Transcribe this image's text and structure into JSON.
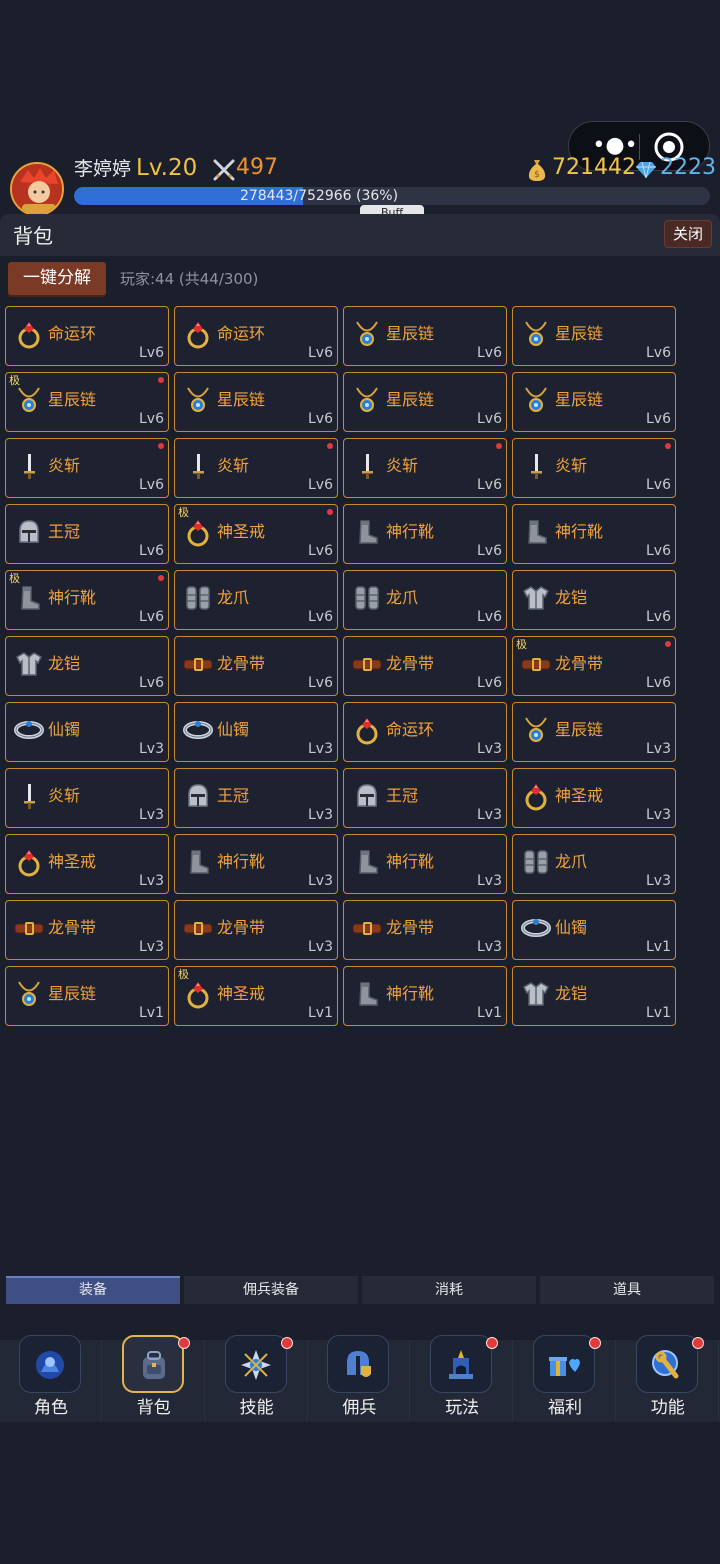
{
  "header": {
    "player_name": "李婷婷",
    "level": "Lv.20",
    "power": "497",
    "gold": "721442",
    "gems": "2223",
    "xp_text": "278443/752966 (36%)",
    "xp_fraction": 0.36,
    "buff_label": "Buff"
  },
  "window": {
    "title": "背包",
    "close_label": "关闭",
    "decompose_label": "一键分解",
    "player_info": "玩家:44 (共44/300)"
  },
  "items": [
    {
      "name": "命运环",
      "level": "Lv6",
      "icon": "ring-icon",
      "badge": "",
      "dot": false
    },
    {
      "name": "命运环",
      "level": "Lv6",
      "icon": "ring-icon",
      "badge": "",
      "dot": false
    },
    {
      "name": "星辰链",
      "level": "Lv6",
      "icon": "necklace-icon",
      "badge": "",
      "dot": false
    },
    {
      "name": "星辰链",
      "level": "Lv6",
      "icon": "necklace-icon",
      "badge": "",
      "dot": false
    },
    {
      "name": "星辰链",
      "level": "Lv6",
      "icon": "necklace-icon",
      "badge": "极",
      "dot": true
    },
    {
      "name": "星辰链",
      "level": "Lv6",
      "icon": "necklace-icon",
      "badge": "",
      "dot": false
    },
    {
      "name": "星辰链",
      "level": "Lv6",
      "icon": "necklace-icon",
      "badge": "",
      "dot": false
    },
    {
      "name": "星辰链",
      "level": "Lv6",
      "icon": "necklace-icon",
      "badge": "",
      "dot": false
    },
    {
      "name": "炎斩",
      "level": "Lv6",
      "icon": "sword-icon",
      "badge": "",
      "dot": true
    },
    {
      "name": "炎斩",
      "level": "Lv6",
      "icon": "sword-icon",
      "badge": "",
      "dot": true
    },
    {
      "name": "炎斩",
      "level": "Lv6",
      "icon": "sword-icon",
      "badge": "",
      "dot": true
    },
    {
      "name": "炎斩",
      "level": "Lv6",
      "icon": "sword-icon",
      "badge": "",
      "dot": true
    },
    {
      "name": "王冠",
      "level": "Lv6",
      "icon": "helmet-icon",
      "badge": "",
      "dot": false
    },
    {
      "name": "神圣戒",
      "level": "Lv6",
      "icon": "ring-icon",
      "badge": "极",
      "dot": true
    },
    {
      "name": "神行靴",
      "level": "Lv6",
      "icon": "boot-icon",
      "badge": "",
      "dot": false
    },
    {
      "name": "神行靴",
      "level": "Lv6",
      "icon": "boot-icon",
      "badge": "",
      "dot": false
    },
    {
      "name": "神行靴",
      "level": "Lv6",
      "icon": "boot-icon",
      "badge": "极",
      "dot": true
    },
    {
      "name": "龙爪",
      "level": "Lv6",
      "icon": "gauntlet-icon",
      "badge": "",
      "dot": false
    },
    {
      "name": "龙爪",
      "level": "Lv6",
      "icon": "gauntlet-icon",
      "badge": "",
      "dot": false
    },
    {
      "name": "龙铠",
      "level": "Lv6",
      "icon": "armor-icon",
      "badge": "",
      "dot": false
    },
    {
      "name": "龙铠",
      "level": "Lv6",
      "icon": "armor-icon",
      "badge": "",
      "dot": false
    },
    {
      "name": "龙骨带",
      "level": "Lv6",
      "icon": "belt-icon",
      "badge": "",
      "dot": false
    },
    {
      "name": "龙骨带",
      "level": "Lv6",
      "icon": "belt-icon",
      "badge": "",
      "dot": false
    },
    {
      "name": "龙骨带",
      "level": "Lv6",
      "icon": "belt-icon",
      "badge": "极",
      "dot": true
    },
    {
      "name": "仙镯",
      "level": "Lv3",
      "icon": "bracelet-icon",
      "badge": "",
      "dot": false
    },
    {
      "name": "仙镯",
      "level": "Lv3",
      "icon": "bracelet-icon",
      "badge": "",
      "dot": false
    },
    {
      "name": "命运环",
      "level": "Lv3",
      "icon": "ring-icon",
      "badge": "",
      "dot": false
    },
    {
      "name": "星辰链",
      "level": "Lv3",
      "icon": "necklace-icon",
      "badge": "",
      "dot": false
    },
    {
      "name": "炎斩",
      "level": "Lv3",
      "icon": "sword-icon",
      "badge": "",
      "dot": false
    },
    {
      "name": "王冠",
      "level": "Lv3",
      "icon": "helmet-icon",
      "badge": "",
      "dot": false
    },
    {
      "name": "王冠",
      "level": "Lv3",
      "icon": "helmet-icon",
      "badge": "",
      "dot": false
    },
    {
      "name": "神圣戒",
      "level": "Lv3",
      "icon": "ring-icon",
      "badge": "",
      "dot": false
    },
    {
      "name": "神圣戒",
      "level": "Lv3",
      "icon": "ring-icon",
      "badge": "",
      "dot": false
    },
    {
      "name": "神行靴",
      "level": "Lv3",
      "icon": "boot-icon",
      "badge": "",
      "dot": false
    },
    {
      "name": "神行靴",
      "level": "Lv3",
      "icon": "boot-icon",
      "badge": "",
      "dot": false
    },
    {
      "name": "龙爪",
      "level": "Lv3",
      "icon": "gauntlet-icon",
      "badge": "",
      "dot": false
    },
    {
      "name": "龙骨带",
      "level": "Lv3",
      "icon": "belt-icon",
      "badge": "",
      "dot": false
    },
    {
      "name": "龙骨带",
      "level": "Lv3",
      "icon": "belt-icon",
      "badge": "",
      "dot": false
    },
    {
      "name": "龙骨带",
      "level": "Lv3",
      "icon": "belt-icon",
      "badge": "",
      "dot": false
    },
    {
      "name": "仙镯",
      "level": "Lv1",
      "icon": "bracelet-icon",
      "badge": "",
      "dot": false
    },
    {
      "name": "星辰链",
      "level": "Lv1",
      "icon": "necklace-icon",
      "badge": "",
      "dot": false
    },
    {
      "name": "神圣戒",
      "level": "Lv1",
      "icon": "ring-icon",
      "badge": "极",
      "dot": false
    },
    {
      "name": "神行靴",
      "level": "Lv1",
      "icon": "boot-icon",
      "badge": "",
      "dot": false
    },
    {
      "name": "龙铠",
      "level": "Lv1",
      "icon": "armor-icon",
      "badge": "",
      "dot": false
    }
  ],
  "tabs": [
    {
      "label": "装备",
      "active": true
    },
    {
      "label": "佣兵装备",
      "active": false
    },
    {
      "label": "消耗",
      "active": false
    },
    {
      "label": "道具",
      "active": false
    }
  ],
  "nav": [
    {
      "label": "角色",
      "icon": "character-icon",
      "active": false,
      "dot": false
    },
    {
      "label": "背包",
      "icon": "backpack-icon",
      "active": true,
      "dot": true
    },
    {
      "label": "技能",
      "icon": "skill-icon",
      "active": false,
      "dot": true
    },
    {
      "label": "佣兵",
      "icon": "mercenary-icon",
      "active": false,
      "dot": false
    },
    {
      "label": "玩法",
      "icon": "gameplay-icon",
      "active": false,
      "dot": true
    },
    {
      "label": "福利",
      "icon": "gift-icon",
      "active": false,
      "dot": true
    },
    {
      "label": "功能",
      "icon": "function-icon",
      "active": false,
      "dot": true
    }
  ],
  "colors": {
    "item_border": "#c98a2e",
    "item_name": "#f2a23a",
    "level_text": "#f1c23e",
    "gold_text": "#f3c547",
    "gem_text": "#5fb4ea",
    "xp_fill": "#2f6fd6",
    "red_dot": "#e03b3b"
  }
}
